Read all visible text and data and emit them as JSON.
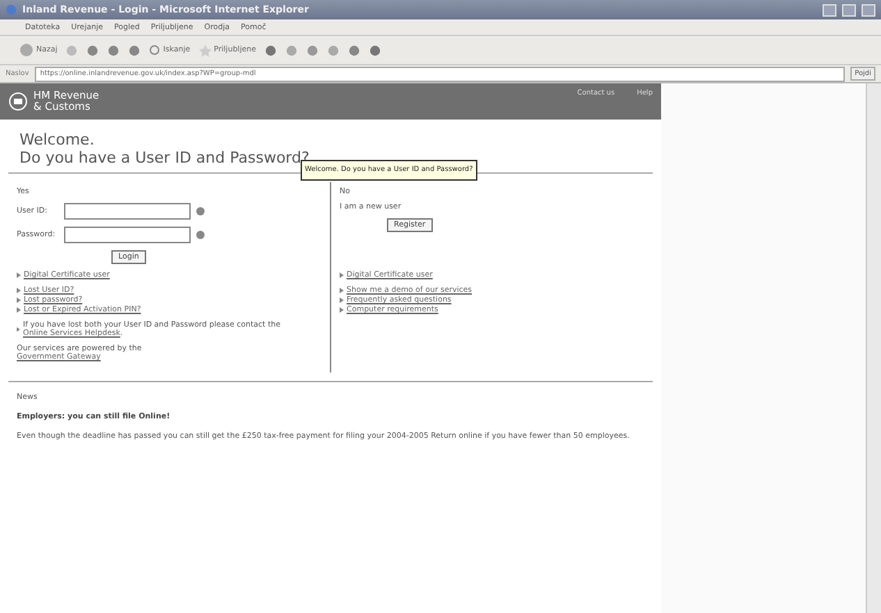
{
  "window": {
    "title": "Inland Revenue - Login - Microsoft Internet Explorer"
  },
  "menu": [
    "Datoteka",
    "Urejanje",
    "Pogled",
    "Priljubljene",
    "Orodja",
    "Pomoč"
  ],
  "toolbar": {
    "back": "Nazaj",
    "search": "Iskanje",
    "favorites": "Priljubljene"
  },
  "address": {
    "label": "Naslov",
    "url": "https://online.inlandrevenue.gov.uk/index.asp?WP=group-mdl",
    "go": "Pojdi"
  },
  "header": {
    "logo": [
      "HM Revenue",
      "& Customs"
    ],
    "links": [
      "Contact us",
      "Help"
    ]
  },
  "welcome": [
    "Welcome.",
    "Do you have a User ID and Password?"
  ],
  "tooltip": "Welcome. Do you have a User ID and Password?",
  "yes_panel": {
    "heading": "Yes",
    "fields": [
      {
        "label": "User ID:"
      },
      {
        "label": "Password:"
      }
    ],
    "button": "Login",
    "cert_link": "Digital Certificate user",
    "lost_links": [
      "Lost User ID?",
      "Lost password?",
      "Lost or Expired Activation PIN?"
    ],
    "contact_text": "If you have lost both your User ID and Password please contact the",
    "contact_link": "Online Services Helpdesk",
    "contact_end": ".",
    "powered_text": "Our services are powered by the",
    "powered_link": "Government Gateway"
  },
  "no_panel": {
    "heading": "No",
    "text": "I am a new user",
    "button": "Register",
    "cert_link": "Digital Certificate user",
    "links": [
      "Show me a demo of our services",
      "Frequently asked questions",
      "Computer requirements"
    ]
  },
  "news": {
    "heading": "News",
    "title": "Employers: you can still file Online!",
    "body": "Even though the deadline has passed you can still get the £250 tax-free payment for filing your 2004-2005 Return online if you have fewer than 50 employees."
  }
}
